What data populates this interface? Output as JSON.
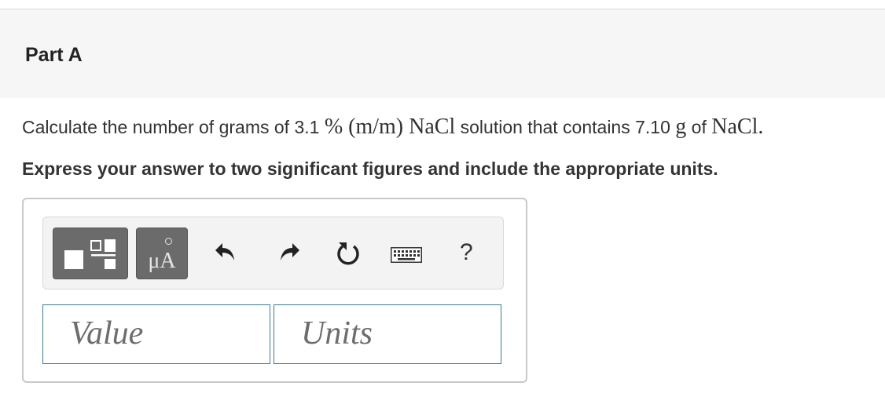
{
  "part": {
    "title": "Part A"
  },
  "question": {
    "prefix": "Calculate the number of grams of 3.1 ",
    "percent": "%",
    "mm": "(m/m)",
    "nacl1": "NaCl",
    "middle": " solution that contains 7.10 ",
    "g": "g",
    "of": " of ",
    "nacl2": "NaCl",
    "end": "."
  },
  "instruction": "Express your answer to two significant figures and include the appropriate units.",
  "toolbar": {
    "units_label": "μA",
    "help_label": "?",
    "icons": [
      "templates-icon",
      "undo-icon",
      "redo-icon",
      "reset-icon",
      "keyboard-icon",
      "help-icon"
    ]
  },
  "answer": {
    "value_placeholder": "Value",
    "units_placeholder": "Units"
  },
  "colors": {
    "header_bg": "#f6f6f6",
    "toolbar_button": "#6b6b6b",
    "field_border": "#3c7c8c"
  }
}
